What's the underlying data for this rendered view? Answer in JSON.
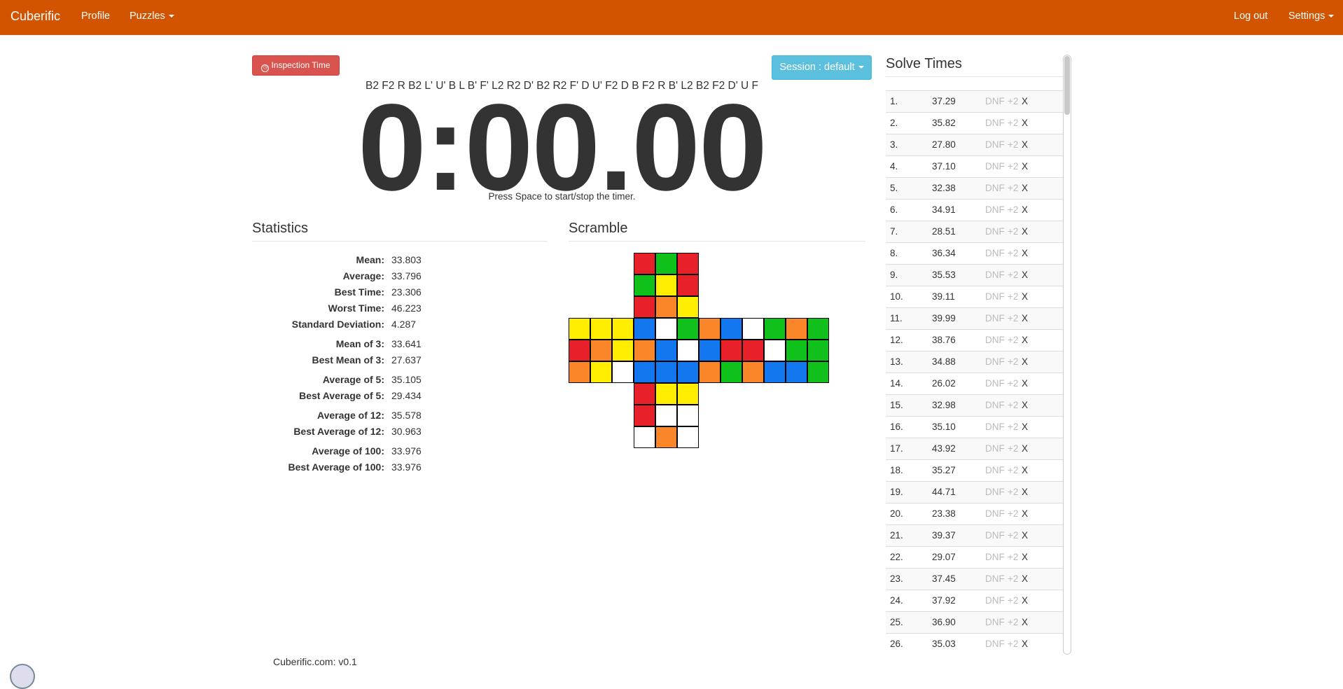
{
  "nav": {
    "brand": "Cuberific",
    "profile": "Profile",
    "puzzles": "Puzzles",
    "logout": "Log out",
    "settings": "Settings"
  },
  "inspection_label": "Inspection Time",
  "session_label": "Session : default",
  "scramble": "B2 F2 R B2 L' U' B L B' F' L2 R2 D' B2 R2 F' D U' F2 D B F2 R B' L2 B2 F2 D' U F",
  "timer": "0:00.00",
  "hint": "Press Space to start/stop the timer.",
  "statistics": {
    "title": "Statistics",
    "rows": [
      {
        "label": "Mean:",
        "value": "33.803"
      },
      {
        "label": "Average:",
        "value": "33.796"
      },
      {
        "label": "Best Time:",
        "value": "23.306"
      },
      {
        "label": "Worst Time:",
        "value": "46.223"
      },
      {
        "label": "Standard Deviation:",
        "value": "4.287"
      },
      {
        "label": "Mean of 3:",
        "value": "33.641"
      },
      {
        "label": "Best Mean of 3:",
        "value": "27.637"
      },
      {
        "label": "Average of 5:",
        "value": "35.105"
      },
      {
        "label": "Best Average of 5:",
        "value": "29.434"
      },
      {
        "label": "Average of 12:",
        "value": "35.578"
      },
      {
        "label": "Best Average of 12:",
        "value": "30.963"
      },
      {
        "label": "Average of 100:",
        "value": "33.976"
      },
      {
        "label": "Best Average of 100:",
        "value": "33.976"
      }
    ]
  },
  "scramble_section": {
    "title": "Scramble",
    "colors": {
      "R": "#e8202a",
      "G": "#11c11b",
      "Y": "#ffee00",
      "O": "#fb8629",
      "B": "#1377f0",
      "W": "#ffffff"
    },
    "faces": {
      "U": [
        "RGR",
        "GYR",
        "ROY"
      ],
      "L": [
        "YYY",
        "ROY",
        "OYW"
      ],
      "F": [
        "BWG",
        "OBW",
        "BBB"
      ],
      "R": [
        "OBW",
        "BRR",
        "OGO"
      ],
      "Bk": [
        "GOG",
        "WGG",
        "BBG"
      ],
      "D": [
        "RYY",
        "RWW",
        "WOW"
      ]
    }
  },
  "solve_times": {
    "title": "Solve Times",
    "dnf": "DNF",
    "plus2": "+2",
    "x": "X",
    "rows": [
      {
        "n": "1.",
        "t": "37.29"
      },
      {
        "n": "2.",
        "t": "35.82"
      },
      {
        "n": "3.",
        "t": "27.80"
      },
      {
        "n": "4.",
        "t": "37.10"
      },
      {
        "n": "5.",
        "t": "32.38"
      },
      {
        "n": "6.",
        "t": "34.91"
      },
      {
        "n": "7.",
        "t": "28.51"
      },
      {
        "n": "8.",
        "t": "36.34"
      },
      {
        "n": "9.",
        "t": "35.53"
      },
      {
        "n": "10.",
        "t": "39.11"
      },
      {
        "n": "11.",
        "t": "39.99"
      },
      {
        "n": "12.",
        "t": "38.76"
      },
      {
        "n": "13.",
        "t": "34.88"
      },
      {
        "n": "14.",
        "t": "26.02"
      },
      {
        "n": "15.",
        "t": "32.98"
      },
      {
        "n": "16.",
        "t": "35.10"
      },
      {
        "n": "17.",
        "t": "43.92"
      },
      {
        "n": "18.",
        "t": "35.27"
      },
      {
        "n": "19.",
        "t": "44.71"
      },
      {
        "n": "20.",
        "t": "23.38"
      },
      {
        "n": "21.",
        "t": "39.37"
      },
      {
        "n": "22.",
        "t": "29.07"
      },
      {
        "n": "23.",
        "t": "37.45"
      },
      {
        "n": "24.",
        "t": "37.92"
      },
      {
        "n": "25.",
        "t": "36.90"
      },
      {
        "n": "26.",
        "t": "35.03"
      }
    ]
  },
  "footer": "Cuberific.com: v0.1"
}
